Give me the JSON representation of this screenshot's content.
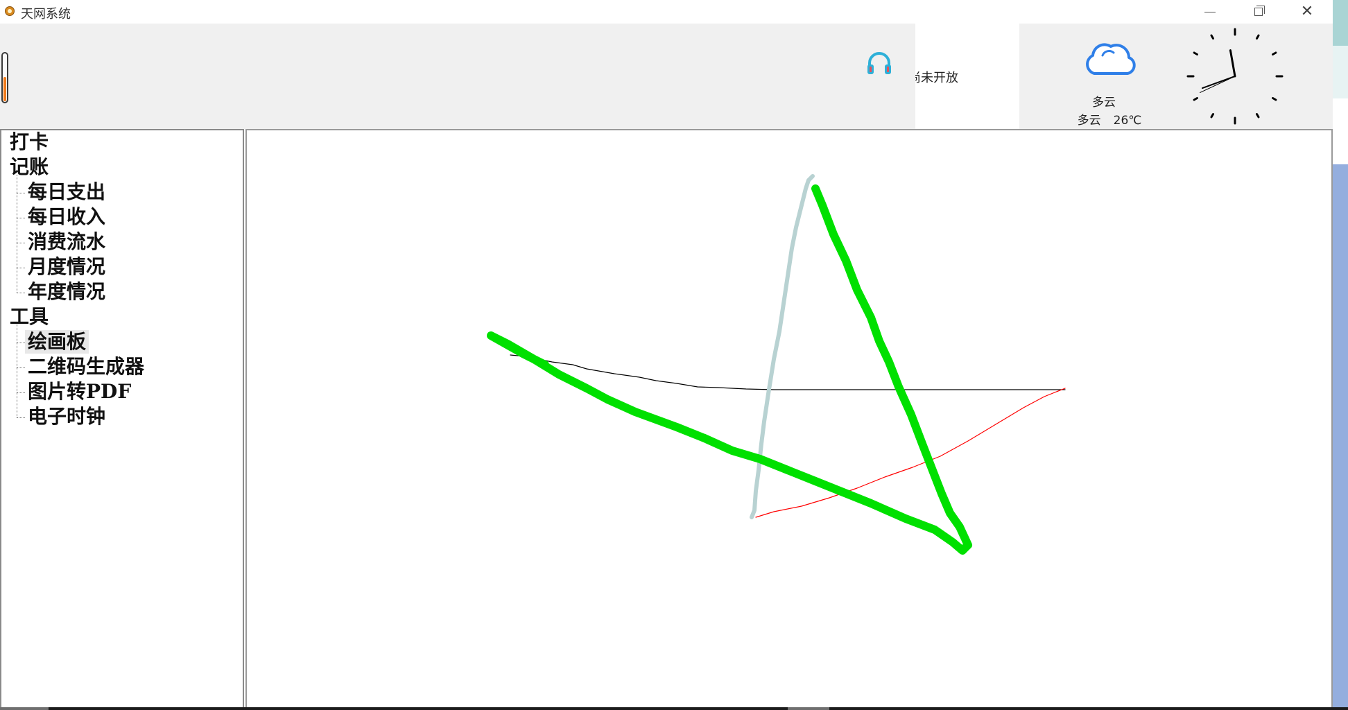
{
  "window": {
    "title": "天网系统",
    "close_glyph": "✕"
  },
  "header": {
    "thermometer_level": 0.5,
    "notice_text": "尚未开放",
    "weather": {
      "condition_label": "多云",
      "condition": "多云",
      "temperature": "26℃"
    },
    "clock": {
      "hour_hand_angle_deg": 250,
      "minute_hand_angle_deg": 350,
      "second_hand_angle_deg": 245
    }
  },
  "sidebar": {
    "groups": [
      {
        "label": "打卡",
        "children": []
      },
      {
        "label": "记账",
        "children": [
          "每日支出",
          "每日收入",
          "消费流水",
          "月度情况",
          "年度情况"
        ]
      },
      {
        "label": "工具",
        "children": [
          "绘画板",
          "二维码生成器",
          "图片转PDF",
          "电子时钟"
        ]
      }
    ],
    "selected": "绘画板"
  },
  "canvas": {
    "strokes": [
      {
        "color": "#000000",
        "width": 1.2
      },
      {
        "color": "#ff0000",
        "width": 1.2
      },
      {
        "color": "#b8d2d2",
        "width": 6
      },
      {
        "color": "#00e000",
        "width": 12
      }
    ]
  },
  "colors": {
    "thermometer_fill": "#f07a1a",
    "headphones": "#2eb0d8",
    "cloud_stroke": "#2f7fe8"
  },
  "icons": {
    "app": "app-logo-icon",
    "minimize": "minimize-icon",
    "maximize": "restore-icon",
    "close": "close-icon",
    "music": "headphones-icon",
    "weather": "cloud-icon"
  }
}
